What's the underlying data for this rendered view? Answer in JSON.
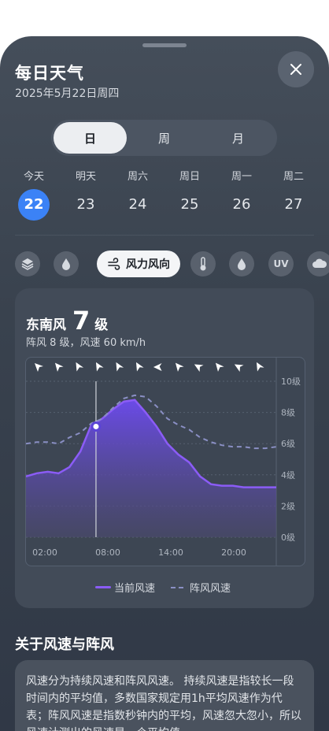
{
  "header": {
    "title": "每日天气",
    "date": "2025年5月22日周四"
  },
  "segment": {
    "options": [
      "日",
      "周",
      "月"
    ],
    "selected": "日"
  },
  "days": [
    {
      "weekday": "今天",
      "num": "22",
      "selected": true
    },
    {
      "weekday": "明天",
      "num": "23"
    },
    {
      "weekday": "周六",
      "num": "24"
    },
    {
      "weekday": "周日",
      "num": "25"
    },
    {
      "weekday": "周一",
      "num": "26"
    },
    {
      "weekday": "周二",
      "num": "27"
    }
  ],
  "chips": {
    "icons": [
      "layers-icon",
      "raindrop-icon",
      "wind-icon",
      "thermometer-icon",
      "humidity-icon",
      "uv-icon",
      "cloud-icon"
    ],
    "active_label": "风力风向",
    "uv_label": "UV"
  },
  "wind": {
    "direction": "东南风",
    "level": "7",
    "unit": "级",
    "gust_text": "阵风 8 级，风速 60 km/h"
  },
  "chart_data": {
    "type": "area",
    "x": [
      0,
      1,
      2,
      3,
      4,
      5,
      6,
      7,
      8,
      9,
      10,
      11,
      12,
      13,
      14,
      15,
      16,
      17,
      18,
      19,
      20,
      21,
      22,
      23
    ],
    "x_tick_labels": [
      "02:00",
      "08:00",
      "14:00",
      "20:00"
    ],
    "y_ticks": [
      "0级",
      "2级",
      "4级",
      "6级",
      "8级",
      "10级"
    ],
    "ylim": [
      0,
      10
    ],
    "selected_index": 6,
    "series": [
      {
        "name": "当前风速",
        "values": [
          3.9,
          4.1,
          4.2,
          4.1,
          4.5,
          5.5,
          7.2,
          7.6,
          8.2,
          8.7,
          8.8,
          8.0,
          7.1,
          6.0,
          5.3,
          4.8,
          3.9,
          3.4,
          3.3,
          3.3,
          3.2,
          3.2,
          3.2,
          3.2
        ],
        "color": "#8b5cf6"
      },
      {
        "name": "阵风风速",
        "values": [
          6.0,
          6.1,
          6.1,
          6.0,
          6.4,
          6.7,
          7.3,
          7.6,
          8.3,
          8.9,
          9.1,
          9.0,
          8.4,
          7.6,
          7.2,
          6.9,
          6.4,
          6.1,
          5.9,
          5.8,
          5.8,
          5.7,
          5.7,
          5.8
        ],
        "color": "#8a8fc4"
      }
    ],
    "wind_arrow_angles": [
      135,
      140,
      150,
      150,
      150,
      150,
      90,
      140,
      120,
      140,
      120,
      150
    ]
  },
  "colors": {
    "accent": "#3b82f6",
    "current": "#8b5cf6",
    "gust": "#8a8fc4"
  },
  "about": {
    "title": "关于风速与阵风",
    "body": "风速分为持续风速和阵风风速。 持续风速是指较长一段时间内的平均值，多数国家规定用1h平均风速作为代表；阵风风速是指数秒钟内的平均，风速忽大忽小，所以风速计测出的风速是一个平均值。"
  }
}
